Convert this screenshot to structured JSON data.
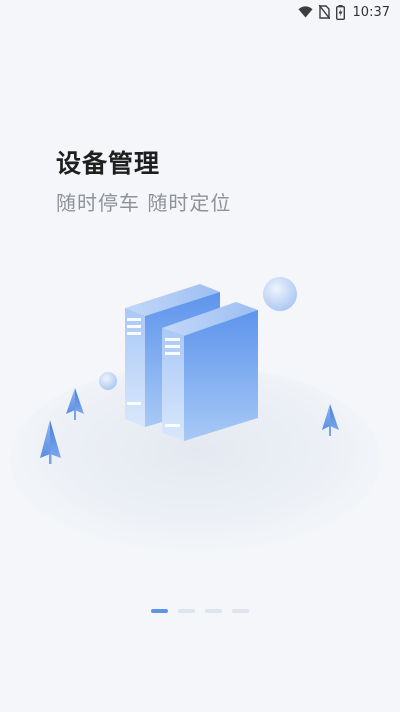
{
  "status_bar": {
    "time": "10:37",
    "icons": [
      "wifi-icon",
      "no-sim-icon",
      "battery-charging-icon"
    ]
  },
  "onboarding": {
    "title": "设备管理",
    "subtitle": "随时停车 随时定位",
    "illustration": "server-rack-illustration",
    "page_indicator": {
      "total": 4,
      "current": 1
    }
  },
  "colors": {
    "accent": "#5b96ea",
    "inactive_dot": "#dde4ee",
    "background": "#f4f6f9",
    "title": "#1f1f1f",
    "subtitle": "#8f9399"
  }
}
